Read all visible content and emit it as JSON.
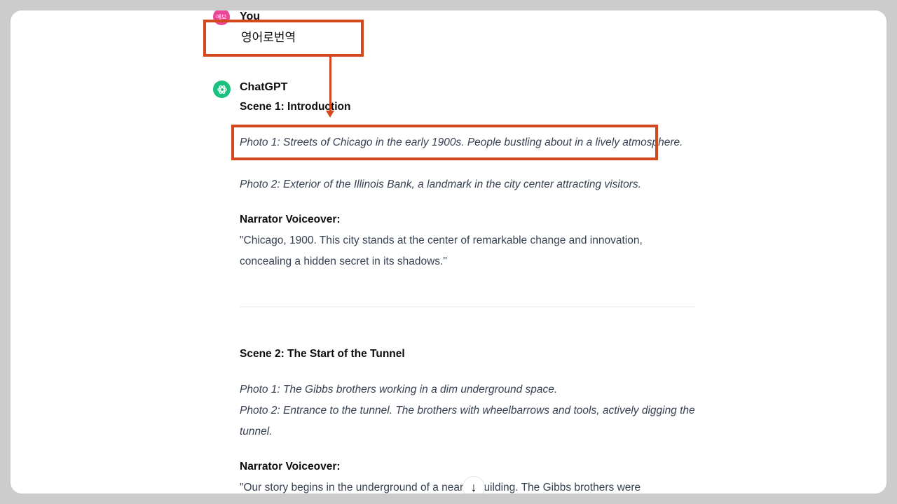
{
  "conversation": {
    "user": {
      "avatar_text": "메모",
      "name": "You",
      "message": "영어로번역"
    },
    "assistant": {
      "name": "ChatGPT",
      "scene1": {
        "heading": "Scene 1: Introduction",
        "photo1": "Photo 1: Streets of Chicago in the early 1900s. People bustling about in a lively atmosphere.",
        "photo2": "Photo 2: Exterior of the Illinois Bank, a landmark in the city center attracting visitors.",
        "voiceover_label": "Narrator Voiceover:",
        "voiceover": "\"Chicago, 1900. This city stands at the center of remarkable change and innovation, concealing a hidden secret in its shadows.\""
      },
      "scene2": {
        "heading": "Scene 2: The Start of the Tunnel",
        "photo1": "Photo 1: The Gibbs brothers working in a dim underground space.",
        "photo2": "Photo 2: Entrance to the tunnel. The brothers with wheelbarrows and tools, actively digging the tunnel.",
        "voiceover_label": "Narrator Voiceover:",
        "voiceover": "\"Our story begins in the underground of a nearby building. The Gibbs brothers were"
      }
    }
  },
  "colors": {
    "highlight": "#d4481e",
    "gpt_avatar": "#19c37d",
    "user_avatar": "#ec4899"
  },
  "icons": {
    "gpt_avatar": "openai-logo-icon",
    "scroll_down": "arrow-down-icon"
  }
}
